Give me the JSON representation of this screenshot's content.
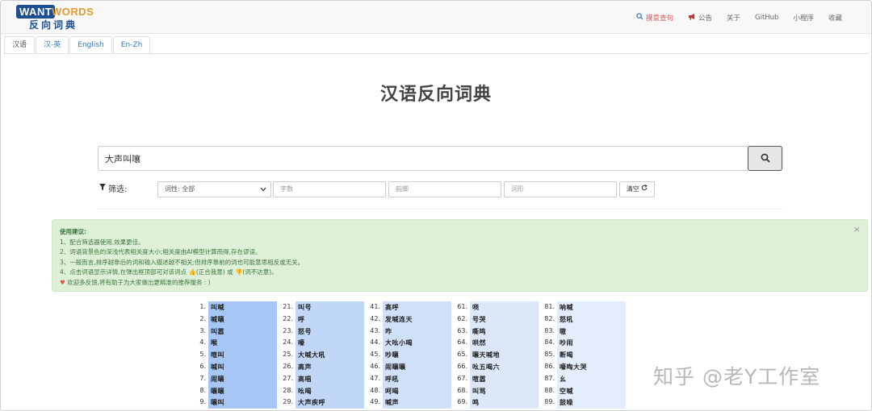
{
  "logo": {
    "want": "WANT",
    "words": "WORDS",
    "cn": "反向词典"
  },
  "nav": {
    "items": [
      {
        "label": "摸意查句",
        "icon": "search-icon",
        "active": true
      },
      {
        "label": "公告",
        "icon": "megaphone-icon",
        "active": false
      },
      {
        "label": "关于",
        "icon": "",
        "active": false
      },
      {
        "label": "GitHub",
        "icon": "",
        "active": false
      },
      {
        "label": "小程序",
        "icon": "",
        "active": false
      },
      {
        "label": "收藏",
        "icon": "",
        "active": false
      }
    ]
  },
  "tabs": [
    {
      "label": "汉语",
      "active": true
    },
    {
      "label": "汉-英",
      "active": false
    },
    {
      "label": "English",
      "active": false
    },
    {
      "label": "En-Zh",
      "active": false
    }
  ],
  "title": "汉语反向词典",
  "search": {
    "value": "大声叫嚷",
    "icon": "search-icon"
  },
  "filter": {
    "label": "筛选:",
    "pos_select": "词性: 全部",
    "char_count_placeholder": "字数",
    "rhyme_placeholder": "韵脚",
    "word_form_placeholder": "词形",
    "clear_label": "清空"
  },
  "tips": {
    "title": "使用建议:",
    "line1": "1、配合筛选器使用,效果更佳。",
    "line2": "2、词语背景色的深浅代表相关度大小;相关度由AI模型计算而得,存在谬误。",
    "line3": "3、一般而言,排序越靠后的词和输入描述越不相关;但排序靠前的词也可能意思相反或无关。",
    "line4": "4、点击词语显示详情,在弹出框顶部可对该词点 👍(正合我意) 或 👎(词不达意)。",
    "line5": "欢迎多反馈,将有助于为大家做出更精准的推荐服务 : )",
    "close": "×"
  },
  "results": {
    "columns": [
      {
        "color": "#a6c7f5",
        "items": [
          {
            "n": "1.",
            "w": "叫喊"
          },
          {
            "n": "2.",
            "w": "喊嚷"
          },
          {
            "n": "3.",
            "w": "叫嚣"
          },
          {
            "n": "4.",
            "w": "喉"
          },
          {
            "n": "5.",
            "w": "喧叫"
          },
          {
            "n": "6.",
            "w": "喊叫"
          },
          {
            "n": "7.",
            "w": "闹嚷"
          },
          {
            "n": "8.",
            "w": "嚷嚷"
          },
          {
            "n": "9.",
            "w": "嚷叫"
          }
        ]
      },
      {
        "color": "#c1d7f7",
        "items": [
          {
            "n": "21.",
            "w": "叫号"
          },
          {
            "n": "22.",
            "w": "呼"
          },
          {
            "n": "23.",
            "w": "怒号"
          },
          {
            "n": "24.",
            "w": "嚎"
          },
          {
            "n": "25.",
            "w": "大喊大吼"
          },
          {
            "n": "26.",
            "w": "高声"
          },
          {
            "n": "27.",
            "w": "高唱"
          },
          {
            "n": "28.",
            "w": "吆喝"
          },
          {
            "n": "29.",
            "w": "大声疾呼"
          }
        ]
      },
      {
        "color": "#cfe0f8",
        "items": [
          {
            "n": "41.",
            "w": "高呼"
          },
          {
            "n": "42.",
            "w": "发喊连天"
          },
          {
            "n": "43.",
            "w": "咋"
          },
          {
            "n": "44.",
            "w": "大吆小喝"
          },
          {
            "n": "45.",
            "w": "吵嚷"
          },
          {
            "n": "46.",
            "w": "闹嚷嚷"
          },
          {
            "n": "47.",
            "w": "呼吼"
          },
          {
            "n": "48.",
            "w": "呵喝"
          },
          {
            "n": "49.",
            "w": "喊声"
          }
        ]
      },
      {
        "color": "#dce8fa",
        "items": [
          {
            "n": "61.",
            "w": "哓"
          },
          {
            "n": "62.",
            "w": "号哭"
          },
          {
            "n": "63.",
            "w": "嘶鸣"
          },
          {
            "n": "64.",
            "w": "哄然"
          },
          {
            "n": "65.",
            "w": "嚷天喊地"
          },
          {
            "n": "66.",
            "w": "吆五喝六"
          },
          {
            "n": "67.",
            "w": "喧嚣"
          },
          {
            "n": "68.",
            "w": "叫骂"
          },
          {
            "n": "69.",
            "w": "鸣"
          }
        ]
      },
      {
        "color": "#e4edfb",
        "items": [
          {
            "n": "81.",
            "w": "呐喊"
          },
          {
            "n": "82.",
            "w": "怒吼"
          },
          {
            "n": "83.",
            "w": "嗷"
          },
          {
            "n": "84.",
            "w": "吵闹"
          },
          {
            "n": "85.",
            "w": "断喝"
          },
          {
            "n": "86.",
            "w": "嚎啕大哭"
          },
          {
            "n": "87.",
            "w": "幺"
          },
          {
            "n": "88.",
            "w": "空喊"
          },
          {
            "n": "89.",
            "w": "鼓噪"
          }
        ]
      }
    ]
  },
  "watermark": "知乎 @老Y工作室"
}
